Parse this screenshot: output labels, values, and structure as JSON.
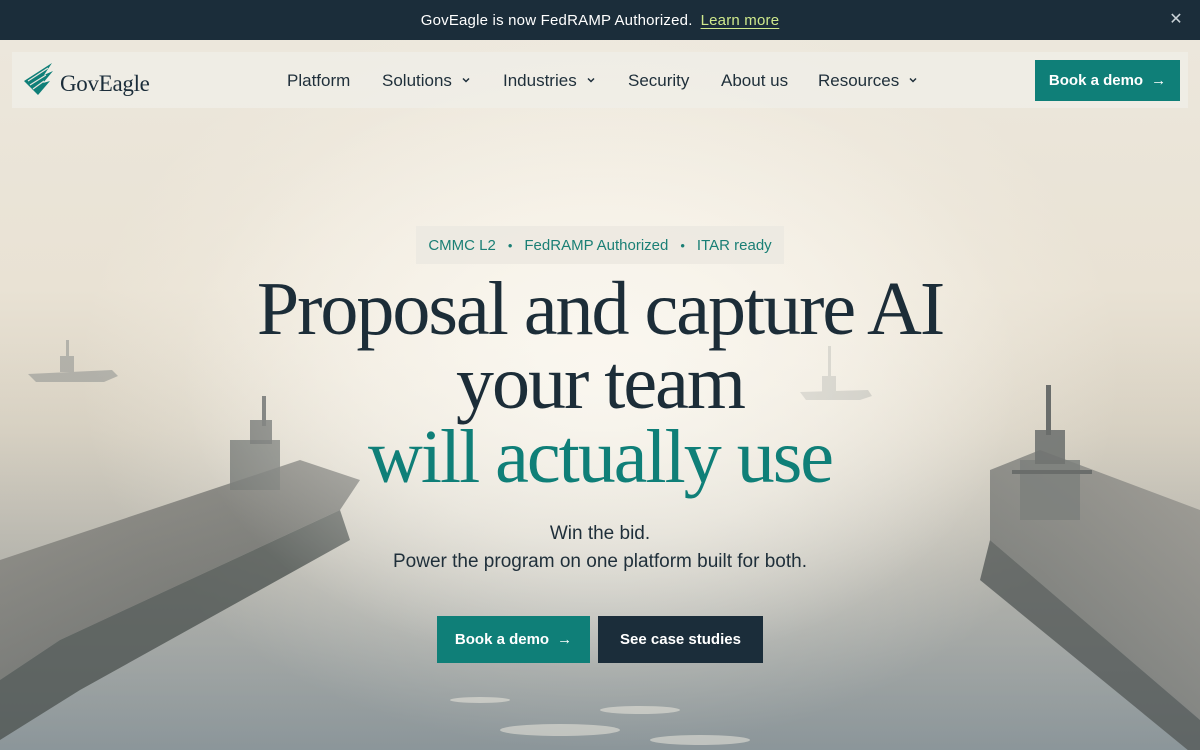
{
  "announcement": {
    "message": "GovEagle is now FedRAMP Authorized.",
    "link_label": "Learn more",
    "close_glyph": "✕"
  },
  "brand": {
    "name": "GovEagle",
    "logo_icon": "eagle-wing-icon"
  },
  "nav": {
    "items": [
      {
        "label": "Platform",
        "has_dropdown": false
      },
      {
        "label": "Solutions",
        "has_dropdown": true
      },
      {
        "label": "Industries",
        "has_dropdown": true
      },
      {
        "label": "Security",
        "has_dropdown": false
      },
      {
        "label": "About us",
        "has_dropdown": false
      },
      {
        "label": "Resources",
        "has_dropdown": true
      }
    ],
    "cta_label": "Book a demo",
    "cta_arrow": "→"
  },
  "hero": {
    "badges": [
      "CMMC L2",
      "FedRAMP Authorized",
      "ITAR ready"
    ],
    "badge_separator": "•",
    "headline_line1": "Proposal and capture AI",
    "headline_line2": "your team",
    "headline_accent": "will actually use",
    "sub_line1": "Win the bid.",
    "sub_line2": "Power the program on one platform built for both.",
    "primary_cta": "Book a demo",
    "primary_cta_arrow": "→",
    "secondary_cta": "See case studies",
    "background_image": "naval-ships-at-sea"
  },
  "colors": {
    "accent": "#0f7f78",
    "dark": "#1b2d3a",
    "announcement_link": "#cfe98c"
  }
}
